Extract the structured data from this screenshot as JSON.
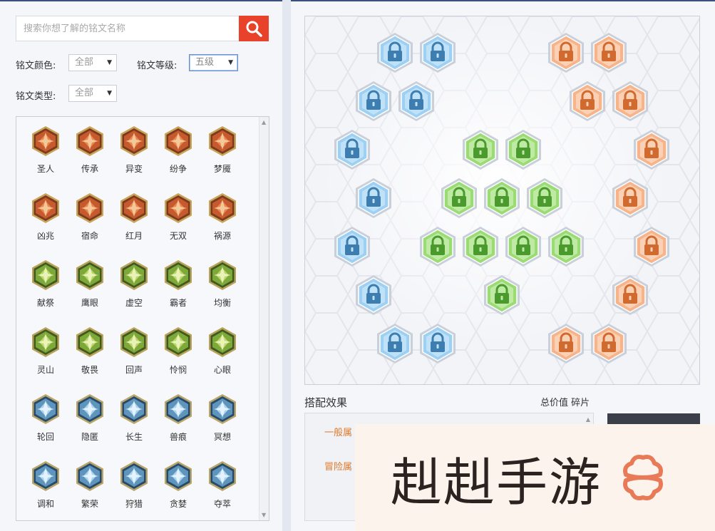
{
  "search": {
    "placeholder": "搜索你想了解的铭文名称"
  },
  "filters": {
    "color_label": "铭文颜色:",
    "color_value": "全部",
    "level_label": "铭文等级:",
    "level_value": "五级",
    "type_label": "铭文类型:",
    "type_value": "全部"
  },
  "runes": [
    {
      "name": "圣人",
      "color": "red"
    },
    {
      "name": "传承",
      "color": "red"
    },
    {
      "name": "异变",
      "color": "red"
    },
    {
      "name": "纷争",
      "color": "red"
    },
    {
      "name": "梦魇",
      "color": "red"
    },
    {
      "name": "凶兆",
      "color": "red"
    },
    {
      "name": "宿命",
      "color": "red"
    },
    {
      "name": "红月",
      "color": "red"
    },
    {
      "name": "无双",
      "color": "red"
    },
    {
      "name": "祸源",
      "color": "red"
    },
    {
      "name": "献祭",
      "color": "green"
    },
    {
      "name": "鹰眼",
      "color": "green"
    },
    {
      "name": "虚空",
      "color": "green"
    },
    {
      "name": "霸者",
      "color": "green"
    },
    {
      "name": "均衡",
      "color": "green"
    },
    {
      "name": "灵山",
      "color": "green"
    },
    {
      "name": "敬畏",
      "color": "green"
    },
    {
      "name": "回声",
      "color": "green"
    },
    {
      "name": "怜悯",
      "color": "green"
    },
    {
      "name": "心眼",
      "color": "green"
    },
    {
      "name": "轮回",
      "color": "blue"
    },
    {
      "name": "隐匿",
      "color": "blue"
    },
    {
      "name": "长生",
      "color": "blue"
    },
    {
      "name": "兽痕",
      "color": "blue"
    },
    {
      "name": "冥想",
      "color": "blue"
    },
    {
      "name": "调和",
      "color": "blue"
    },
    {
      "name": "繁荣",
      "color": "blue"
    },
    {
      "name": "狩猎",
      "color": "blue"
    },
    {
      "name": "贪婪",
      "color": "blue"
    },
    {
      "name": "夺萃",
      "color": "blue"
    }
  ],
  "board": {
    "slot_state": "locked",
    "blue_slots": 10,
    "green_slots": 10,
    "orange_slots": 10
  },
  "combo": {
    "title": "搭配效果",
    "totals_label": "总价值 碎片",
    "line1": "一般属",
    "line2": "冒险属"
  },
  "watermark": {
    "text": "赳赳手游"
  },
  "colors": {
    "accent_red": "#e8432a",
    "blue_slot": "#8ec8ef",
    "green_slot": "#9edc7a",
    "orange_slot": "#f6b48c"
  }
}
